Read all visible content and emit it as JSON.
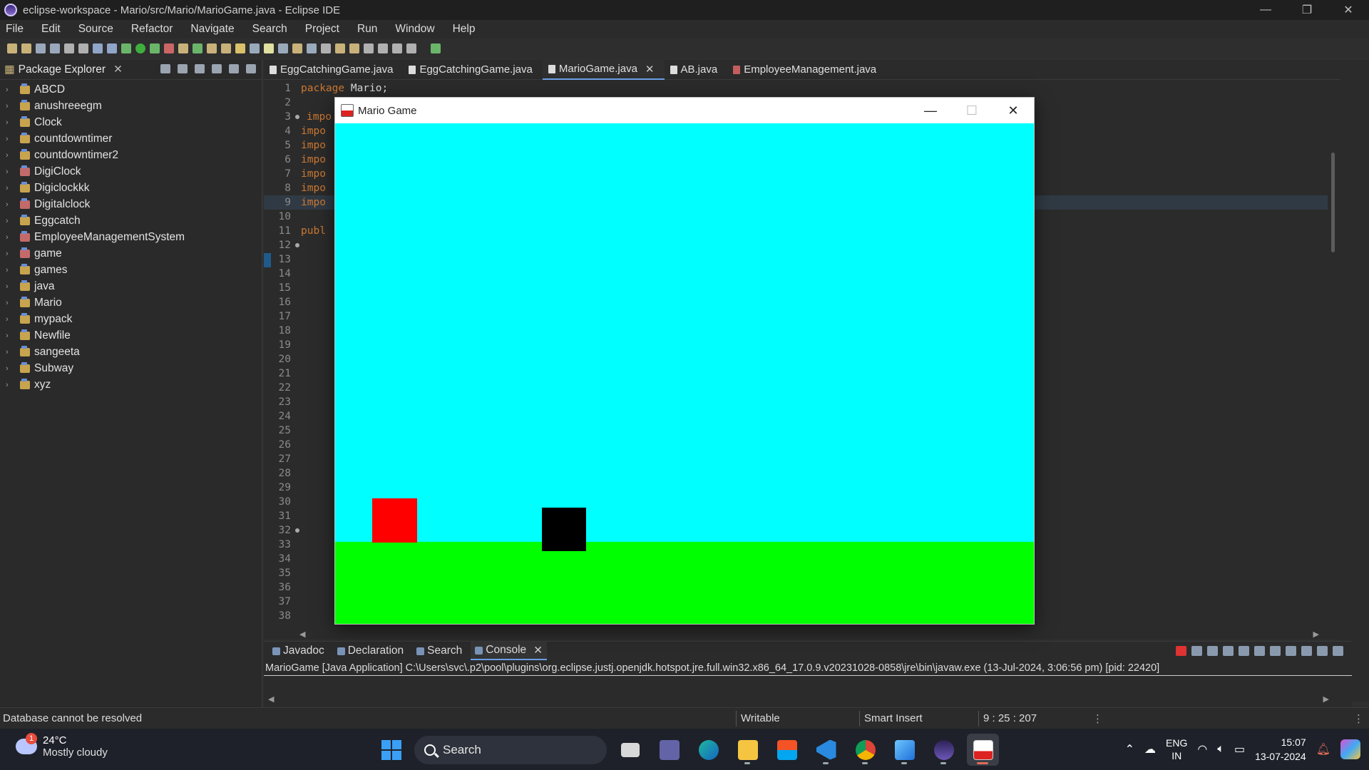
{
  "window": {
    "title": "eclipse-workspace - Mario/src/Mario/MarioGame.java - Eclipse IDE",
    "controls": [
      "—",
      "❐",
      "✕"
    ]
  },
  "menu": [
    "File",
    "Edit",
    "Source",
    "Refactor",
    "Navigate",
    "Search",
    "Project",
    "Run",
    "Window",
    "Help"
  ],
  "package_explorer": {
    "title": "Package Explorer",
    "projects": [
      {
        "name": "ABCD",
        "error": false
      },
      {
        "name": "anushreeegm",
        "error": false
      },
      {
        "name": "Clock",
        "error": false
      },
      {
        "name": "countdowntimer",
        "error": false
      },
      {
        "name": "countdowntimer2",
        "error": false
      },
      {
        "name": "DigiClock",
        "error": true
      },
      {
        "name": "Digiclockkk",
        "error": false
      },
      {
        "name": "Digitalclock",
        "error": true
      },
      {
        "name": "Eggcatch",
        "error": false
      },
      {
        "name": "EmployeeManagementSystem",
        "error": true
      },
      {
        "name": "game",
        "error": true
      },
      {
        "name": "games",
        "error": false
      },
      {
        "name": "java",
        "error": false
      },
      {
        "name": "Mario",
        "error": false
      },
      {
        "name": "mypack",
        "error": false
      },
      {
        "name": "Newfile",
        "error": false
      },
      {
        "name": "sangeeta",
        "error": false
      },
      {
        "name": "Subway",
        "error": false
      },
      {
        "name": "xyz",
        "error": false
      }
    ]
  },
  "editor": {
    "tabs": [
      {
        "label": "EggCatchingGame.java",
        "active": false,
        "error": false
      },
      {
        "label": "EggCatchingGame.java",
        "active": false,
        "error": false
      },
      {
        "label": "MarioGame.java",
        "active": true,
        "error": false
      },
      {
        "label": "AB.java",
        "active": false,
        "error": false
      },
      {
        "label": "EmployeeManagement.java",
        "active": false,
        "error": true
      }
    ],
    "lines": [
      {
        "n": "1",
        "text": "package Mario;",
        "kw": "package"
      },
      {
        "n": "2",
        "text": ""
      },
      {
        "n": "3",
        "text": "impo",
        "kw": "impo",
        "dot": true
      },
      {
        "n": "4",
        "text": "impo",
        "kw": "impo"
      },
      {
        "n": "5",
        "text": "impo",
        "kw": "impo"
      },
      {
        "n": "6",
        "text": "impo",
        "kw": "impo"
      },
      {
        "n": "7",
        "text": "impo",
        "kw": "impo"
      },
      {
        "n": "8",
        "text": "impo",
        "kw": "impo"
      },
      {
        "n": "9",
        "text": "impo",
        "kw": "impo"
      },
      {
        "n": "10",
        "text": ""
      },
      {
        "n": "11",
        "text": "publ",
        "kw": "publ"
      },
      {
        "n": "12",
        "text": "",
        "dot": true
      },
      {
        "n": "13",
        "text": ""
      },
      {
        "n": "14",
        "text": ""
      },
      {
        "n": "15",
        "text": ""
      },
      {
        "n": "16",
        "text": ""
      },
      {
        "n": "17",
        "text": ""
      },
      {
        "n": "18",
        "text": ""
      },
      {
        "n": "19",
        "text": ""
      },
      {
        "n": "20",
        "text": ""
      },
      {
        "n": "21",
        "text": ""
      },
      {
        "n": "22",
        "text": ""
      },
      {
        "n": "23",
        "text": ""
      },
      {
        "n": "24",
        "text": ""
      },
      {
        "n": "25",
        "text": ""
      },
      {
        "n": "26",
        "text": ""
      },
      {
        "n": "27",
        "text": ""
      },
      {
        "n": "28",
        "text": ""
      },
      {
        "n": "29",
        "text": ""
      },
      {
        "n": "30",
        "text": ""
      },
      {
        "n": "31",
        "text": ""
      },
      {
        "n": "32",
        "text": "",
        "dot": true
      },
      {
        "n": "33",
        "text": ""
      },
      {
        "n": "34",
        "text": ""
      },
      {
        "n": "35",
        "text": ""
      },
      {
        "n": "36",
        "text": ""
      },
      {
        "n": "37",
        "text": ""
      },
      {
        "n": "38",
        "text": ""
      }
    ]
  },
  "bottom_panel": {
    "tabs": [
      {
        "label": "Javadoc",
        "active": false
      },
      {
        "label": "Declaration",
        "active": false
      },
      {
        "label": "Search",
        "active": false
      },
      {
        "label": "Console",
        "active": true
      }
    ],
    "console_text": "MarioGame [Java Application] C:\\Users\\svc\\.p2\\pool\\plugins\\org.eclipse.justj.openjdk.hotspot.jre.full.win32.x86_64_17.0.9.v20231028-0858\\jre\\bin\\javaw.exe  (13-Jul-2024, 3:06:56 pm) [pid: 22420]"
  },
  "status": {
    "message": "Database cannot be resolved",
    "writable": "Writable",
    "insert_mode": "Smart Insert",
    "position": "9 : 25 : 207"
  },
  "java_window": {
    "title": "Mario Game",
    "colors": {
      "sky": "#00ffff",
      "ground": "#00ff00",
      "player": "#ff0000",
      "obstacle": "#000000"
    }
  },
  "taskbar": {
    "weather": {
      "temp": "24°C",
      "desc": "Mostly cloudy",
      "badge": "1"
    },
    "search_label": "Search",
    "lang": [
      "ENG",
      "IN"
    ],
    "time": "15:07",
    "date": "13-07-2024"
  }
}
